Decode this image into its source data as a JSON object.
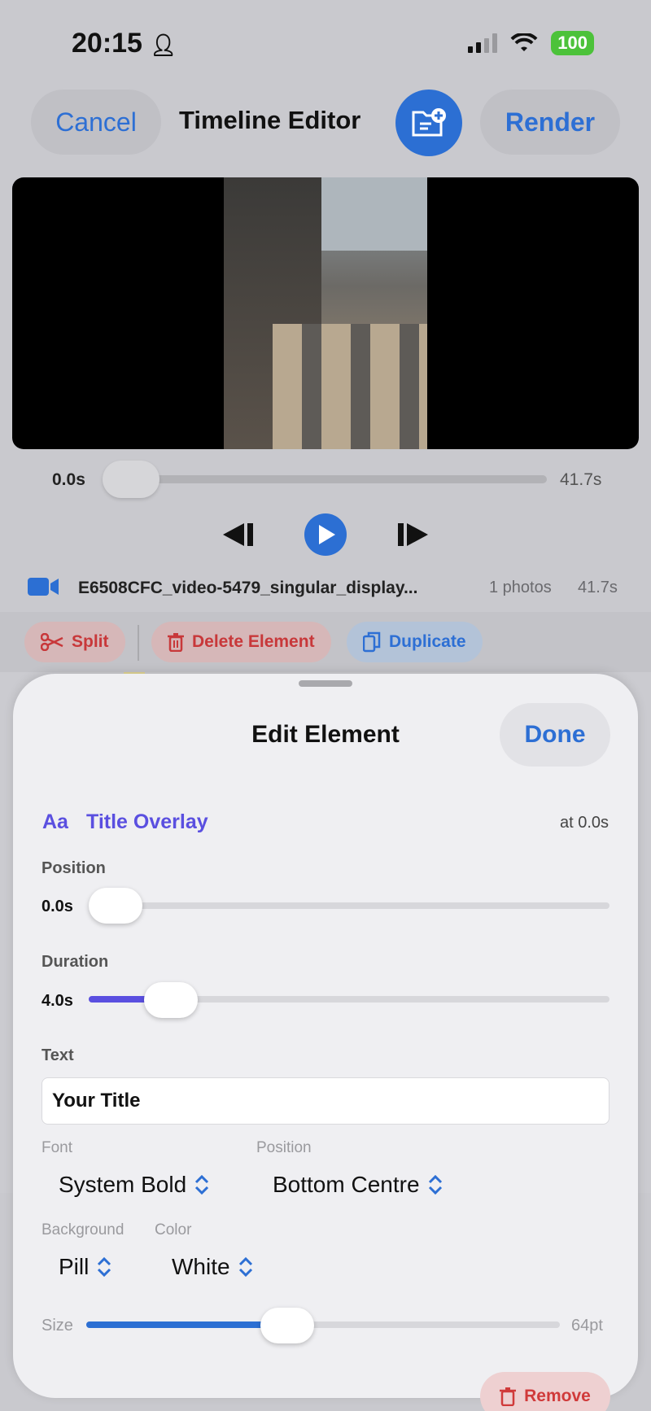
{
  "status": {
    "time": "20:15",
    "battery": "100"
  },
  "nav": {
    "cancel": "Cancel",
    "title": "Timeline Editor",
    "render": "Render"
  },
  "scrubber": {
    "current": "0.0s",
    "total": "41.7s",
    "progress": 0.0
  },
  "clip": {
    "name": "E6508CFC_video-5479_singular_display...",
    "photos": "1 photos",
    "duration": "41.7s"
  },
  "actions": {
    "split": "Split",
    "delete": "Delete Element",
    "duplicate": "Duplicate"
  },
  "sheet": {
    "title": "Edit Element",
    "done": "Done",
    "element_type_icon": "Aa",
    "element_type": "Title Overlay",
    "at": "at 0.0s",
    "position_label": "Position",
    "position_value": "0.0s",
    "position_fraction": 0.0,
    "duration_label": "Duration",
    "duration_value": "4.0s",
    "duration_fraction": 0.1,
    "text_label": "Text",
    "text_value": "Your Title",
    "font_label": "Font",
    "font_value": "System Bold",
    "position2_label": "Position",
    "position2_value": "Bottom Centre",
    "background_label": "Background",
    "background_value": "Pill",
    "color_label": "Color",
    "color_value": "White",
    "size_label": "Size",
    "size_value": "64pt",
    "size_fraction": 0.43,
    "remove": "Remove"
  },
  "colors": {
    "accent": "#2c6fd3",
    "purple": "#5a4fe0",
    "destructive": "#c8383a"
  }
}
